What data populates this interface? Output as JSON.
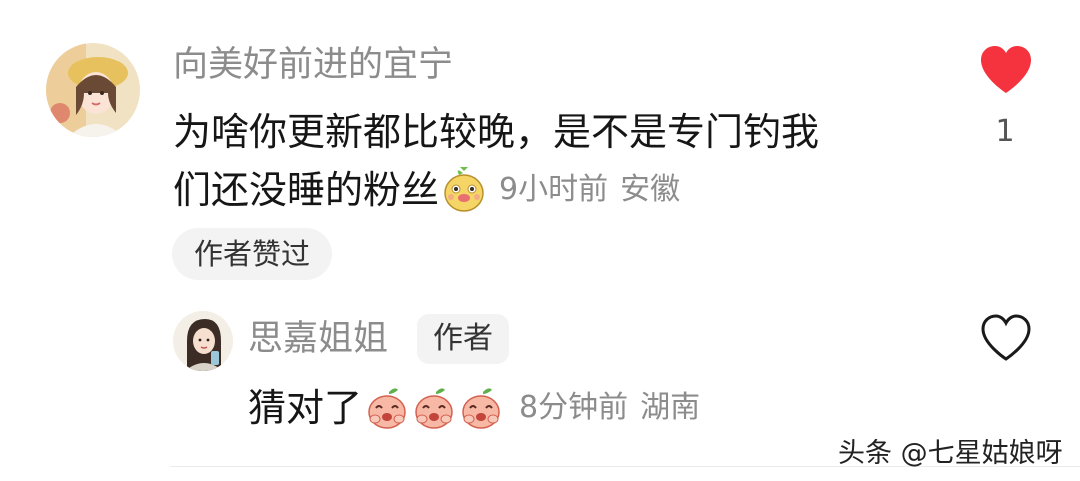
{
  "comment": {
    "username": "向美好前进的宜宁",
    "text_line1": "为啥你更新都比较晚，是不是专门钓我",
    "text_line2": "们还没睡的粉丝",
    "time": "9小时前",
    "location": "安徽",
    "liked_by_author_label": "作者赞过",
    "like_count": "1",
    "liked": true
  },
  "reply": {
    "username": "思嘉姐姐",
    "author_tag": "作者",
    "text": "猜对了",
    "time": "8分钟前",
    "location": "湖南",
    "liked": false
  },
  "watermark": "头条 @七星姑娘呀",
  "colors": {
    "heart_liked": "#f5333f",
    "meta_gray": "#8c8c8c",
    "badge_bg": "#f3f3f3"
  },
  "icons": {
    "comment_emoji": "smiling-potato-emoji",
    "reply_emoji": "peach-laughing-emoji",
    "like_icon": "heart-icon"
  }
}
